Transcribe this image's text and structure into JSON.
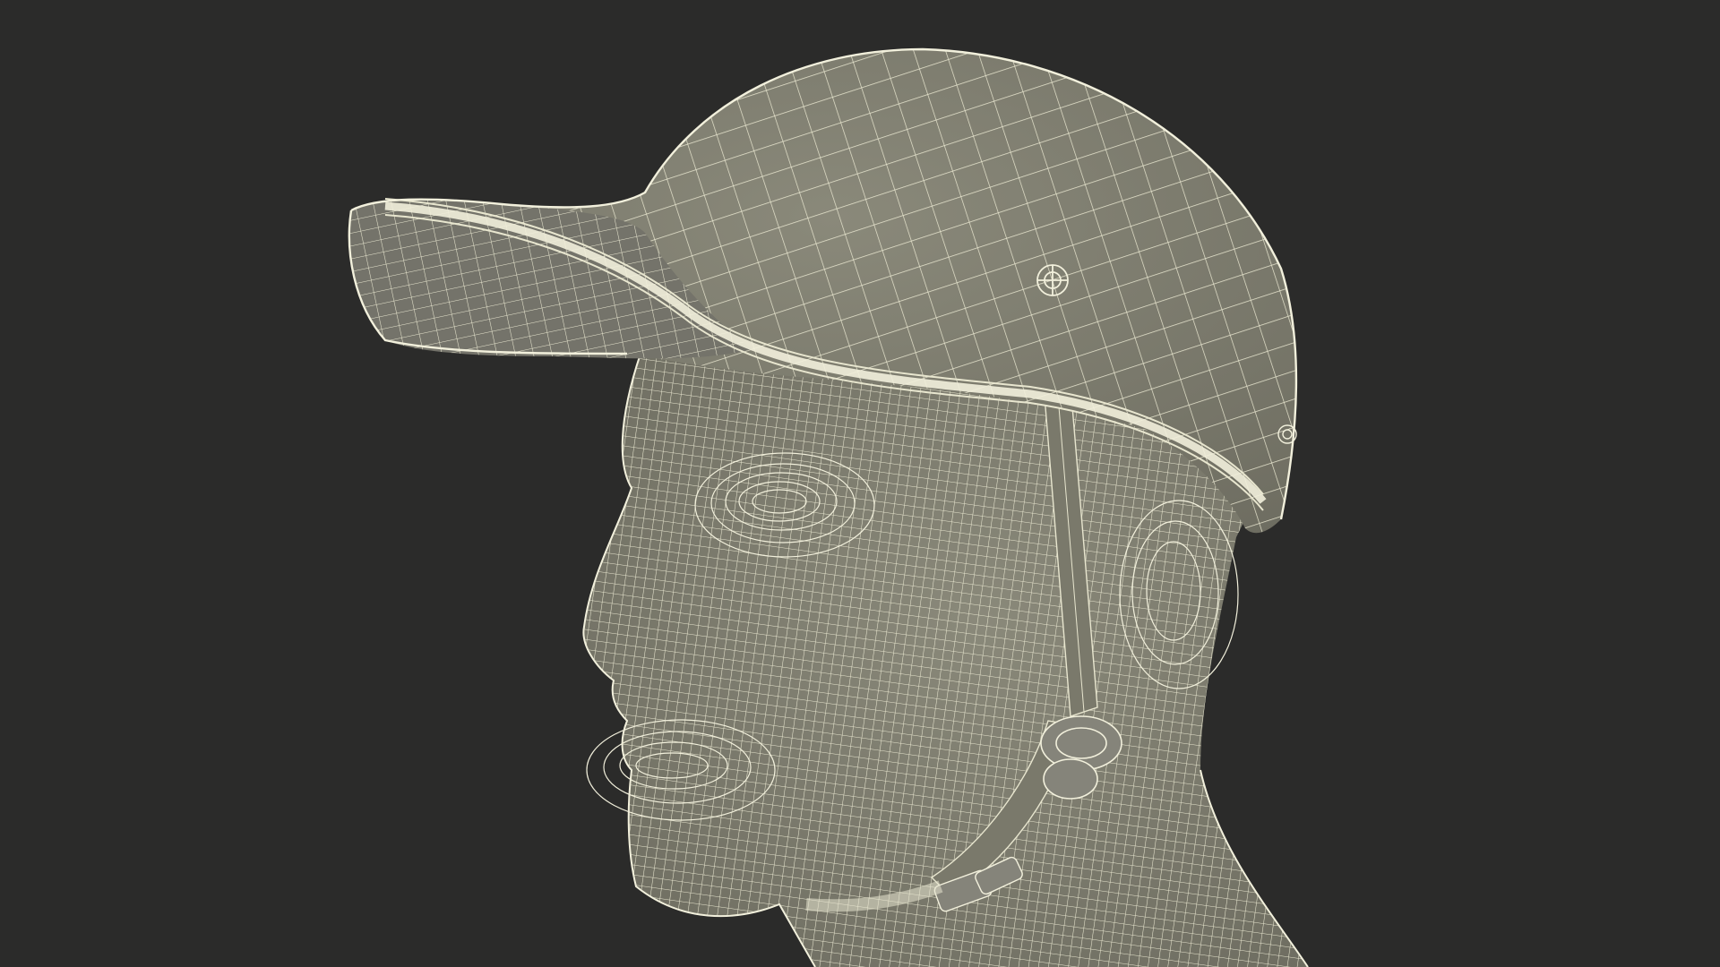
{
  "scene": {
    "subject": "wireframe-head-with-cap",
    "colors": {
      "background": "#2b2b2a",
      "surface": "#7d7c6e",
      "surface_shadow": "#6a695d",
      "wire": "#e8e6cf",
      "wire_dense": "#f2f0dc"
    }
  }
}
